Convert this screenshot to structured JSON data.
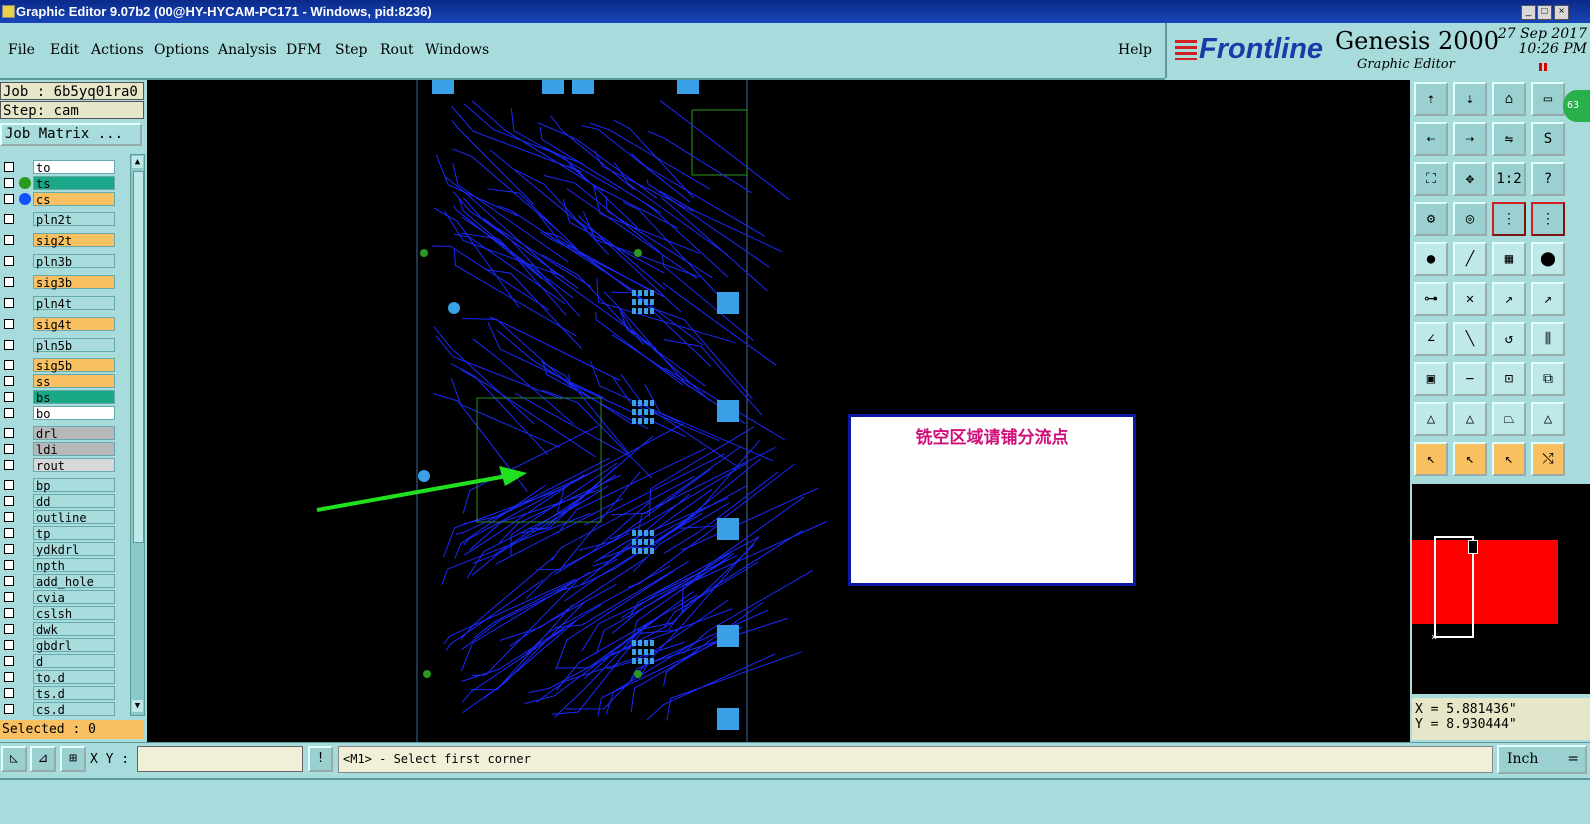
{
  "window": {
    "title": "Graphic Editor 9.07b2 (00@HY-HYCAM-PC171 - Windows, pid:8236)"
  },
  "menu": {
    "items": [
      "File",
      "Edit",
      "Actions",
      "Options",
      "Analysis",
      "DFM",
      "Step",
      "Rout",
      "Windows"
    ],
    "help": "Help"
  },
  "brand": {
    "logo": "Frontline",
    "product": "Genesis 2000",
    "subtitle": "Graphic Editor",
    "date": "27 Sep 2017",
    "time": "10:26 PM"
  },
  "left_panel": {
    "job": "Job : 6b5yq01ra0",
    "step": "Step: cam",
    "job_matrix": "Job Matrix ...",
    "selected": "Selected : 0",
    "layers": [
      {
        "name": "to",
        "color": "#ffffff"
      },
      {
        "name": "ts",
        "color": "#1aa888",
        "dot": "#2a9a20",
        "active": true
      },
      {
        "name": "cs",
        "color": "#f8c060",
        "dot": "#1050ff"
      },
      {
        "name": "pln2t",
        "color": "#a8dcdc"
      },
      {
        "name": "sig2t",
        "color": "#f8c060"
      },
      {
        "name": "pln3b",
        "color": "#a8dcdc"
      },
      {
        "name": "sig3b",
        "color": "#f8c060"
      },
      {
        "name": "pln4t",
        "color": "#a8dcdc"
      },
      {
        "name": "sig4t",
        "color": "#f8c060"
      },
      {
        "name": "pln5b",
        "color": "#a8dcdc"
      },
      {
        "name": "sig5b",
        "color": "#f8c060"
      },
      {
        "name": "ss",
        "color": "#f8c060"
      },
      {
        "name": "bs",
        "color": "#1aa888"
      },
      {
        "name": "bo",
        "color": "#ffffff"
      },
      {
        "name": "drl",
        "color": "#b8b8b8"
      },
      {
        "name": "ldi",
        "color": "#b8b8b8"
      },
      {
        "name": "rout",
        "color": "#d8d8d8"
      },
      {
        "name": "bp",
        "color": "#a8dcdc"
      },
      {
        "name": "dd",
        "color": "#a8dcdc"
      },
      {
        "name": "outline",
        "color": "#a8dcdc"
      },
      {
        "name": "tp",
        "color": "#a8dcdc"
      },
      {
        "name": "ydkdrl",
        "color": "#a8dcdc"
      },
      {
        "name": "npth",
        "color": "#a8dcdc"
      },
      {
        "name": "add_hole",
        "color": "#a8dcdc"
      },
      {
        "name": "cvia",
        "color": "#a8dcdc"
      },
      {
        "name": "cslsh",
        "color": "#a8dcdc"
      },
      {
        "name": "dwk",
        "color": "#a8dcdc"
      },
      {
        "name": "gbdrl",
        "color": "#a8dcdc"
      },
      {
        "name": "d",
        "color": "#a8dcdc"
      },
      {
        "name": "to.d",
        "color": "#a8dcdc"
      },
      {
        "name": "ts.d",
        "color": "#a8dcdc"
      },
      {
        "name": "cs.d",
        "color": "#a8dcdc"
      }
    ]
  },
  "canvas": {
    "message": "铣空区域请铺分流点",
    "trace_color": "#1a2aff",
    "pad_color": "#3aa0e8",
    "arrow_color": "#20e020"
  },
  "toolbox": {
    "badge": "63",
    "buttons": [
      "up-icon",
      "down-icon",
      "home-icon",
      "step-icon",
      "left-icon",
      "right-icon",
      "mirror-icon",
      "s-icon",
      "fit-icon",
      "center-icon",
      "ratio-label",
      "help-icon",
      "settings-icon",
      "target-icon",
      "layers-red-icon",
      "layers-blue-icon",
      "pad-icon",
      "line-icon",
      "ruler-icon",
      "dot-icon",
      "connect-icon",
      "cross-icon",
      "move-icon",
      "move2-icon",
      "angle-icon",
      "diagonal-icon",
      "undo-arc-icon",
      "fence-icon",
      "rect-select-icon",
      "minus-icon",
      "box-icon",
      "group-icon",
      "triangle-icon",
      "triangle2-icon",
      "triangle3-icon",
      "triangle4-icon",
      "pointer-icon",
      "pointer2-icon",
      "pointer3-icon",
      "route-icon"
    ],
    "ratio": "1:2",
    "coord_x": "X = 5.881436\"",
    "coord_y": "Y = 8.930444\""
  },
  "bottom": {
    "xy_label": "X Y :",
    "xy_value": "",
    "prompt": "<M1> - Select first corner",
    "unit": "Inch"
  }
}
